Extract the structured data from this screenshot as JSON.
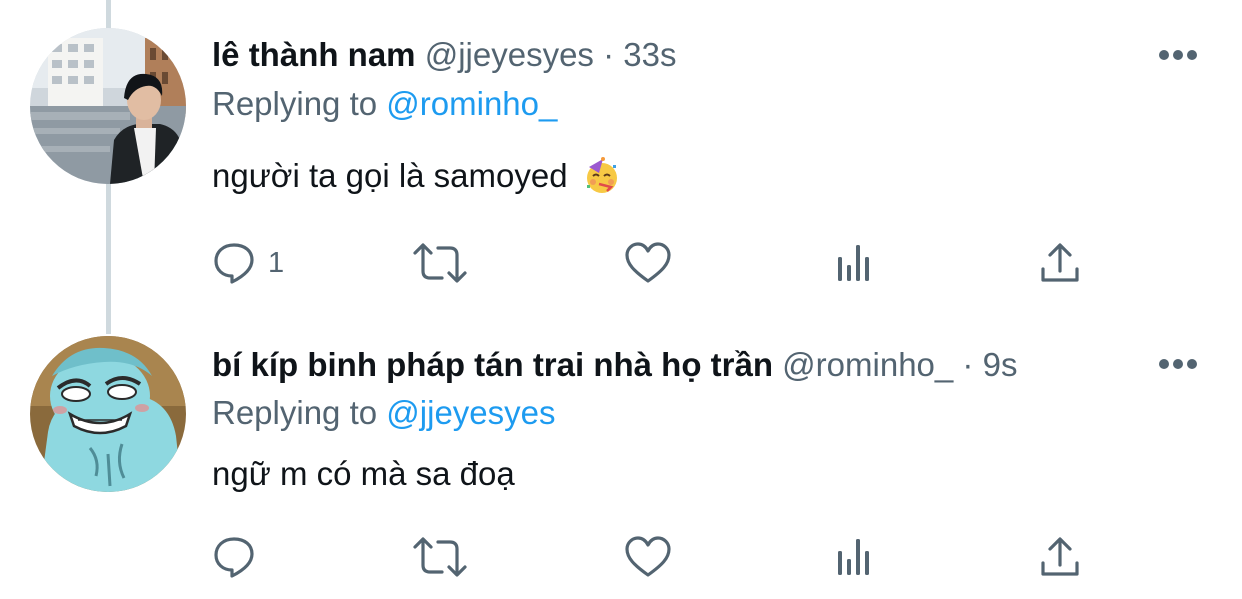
{
  "tweets": [
    {
      "display_name": "lê thành nam",
      "handle": "@jjeyesyes",
      "separator": "·",
      "time": "33s",
      "replying_prefix": "Replying to",
      "replying_to": "@rominho_",
      "text": "người ta gọi là samoyed",
      "emoji": "partying-face-emoji",
      "reply_count": "1",
      "avatar": "photo-man-by-canal"
    },
    {
      "display_name": "bí kíp binh pháp tán trai nhà họ trần",
      "handle": "@rominho_",
      "separator": "·",
      "time": "9s",
      "replying_prefix": "Replying to",
      "replying_to": "@jjeyesyes",
      "text": "ngữ m có mà sa đoạ",
      "reply_count": "",
      "avatar": "cartoon-blue-cat"
    }
  ],
  "icons": {
    "more": "more-horizontal-icon",
    "reply": "reply-bubble-icon",
    "retweet": "retweet-icon",
    "like": "heart-icon",
    "analytics": "analytics-bars-icon",
    "share": "share-upload-icon"
  },
  "colors": {
    "text_primary": "#0f1419",
    "text_secondary": "#536471",
    "link": "#1d9bf0",
    "thread_line": "#cfd9de",
    "icon": "#536471"
  }
}
